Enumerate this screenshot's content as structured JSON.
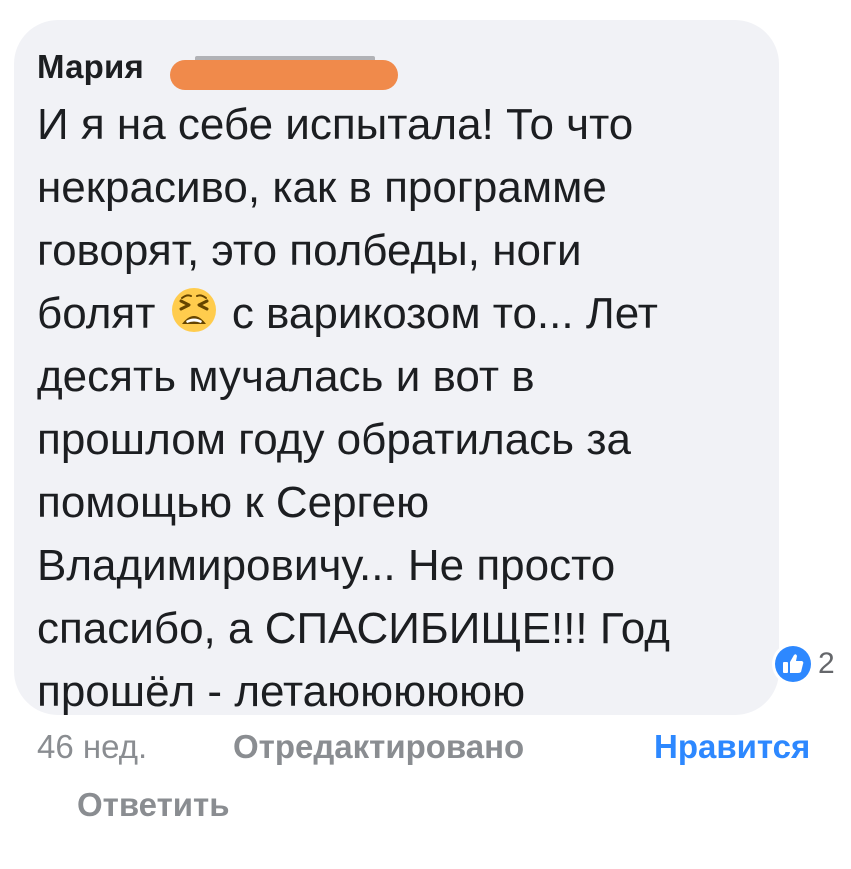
{
  "comment": {
    "author_name": "Мария",
    "text_lines": [
      "И я на себе испытала! То что",
      "некрасиво, как в программе",
      "говорят, это полбеды, ноги",
      "болят",
      "с варикозом то... Лет",
      "десять мучалась и вот в",
      "прошлом году обратилась за",
      "помощью к Сергею",
      "Владимировичу... Не просто",
      "спасибо, а СПАСИБИЩЕ!!! Год",
      "прошёл - летаюююююю"
    ],
    "inline_emoji": "tired-face-emoji",
    "reaction": {
      "icon": "thumbs-up-icon",
      "count": "2"
    }
  },
  "actions": {
    "time_label": "46 нед.",
    "edited_label": "Отредактировано",
    "like_label": "Нравится",
    "reply_label": "Ответить"
  },
  "colors": {
    "bubble_background": "#f1f2f6",
    "text": "#1c1e21",
    "muted": "#8a8d91",
    "like_blue": "#2d88ff",
    "redaction_orange": "#f08a4b"
  }
}
